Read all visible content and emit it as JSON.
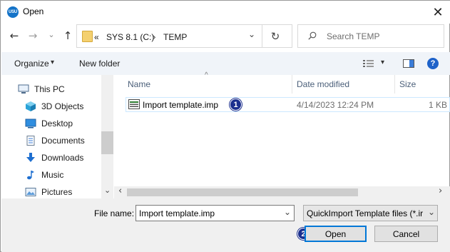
{
  "window": {
    "title": "Open",
    "app_icon_text": "USU",
    "close_glyph": "✕"
  },
  "nav": {
    "back_glyph": "←",
    "forward_glyph": "→",
    "recent_glyph": "⌄",
    "up_glyph": "↑"
  },
  "address": {
    "overflow": "«",
    "segments": [
      "SYS 8.1 (C:)",
      "TEMP"
    ],
    "separator": "›",
    "dropdown_glyph": "⌄",
    "refresh_glyph": "↻"
  },
  "search": {
    "placeholder": "Search TEMP"
  },
  "toolbar": {
    "organize_label": "Organize",
    "organize_arrow": "▾",
    "new_folder_label": "New folder",
    "view_arrow": "▾",
    "help_label": "?"
  },
  "sidebar": {
    "items": [
      {
        "label": "This PC",
        "icon": "computer-icon"
      },
      {
        "label": "3D Objects",
        "icon": "cube-icon"
      },
      {
        "label": "Desktop",
        "icon": "desktop-icon"
      },
      {
        "label": "Documents",
        "icon": "documents-icon"
      },
      {
        "label": "Downloads",
        "icon": "download-icon"
      },
      {
        "label": "Music",
        "icon": "music-icon"
      },
      {
        "label": "Pictures",
        "icon": "pictures-icon"
      }
    ],
    "scroll_down_glyph": "⌄"
  },
  "file_list": {
    "columns": [
      "Name",
      "Date modified",
      "Size"
    ],
    "sort_glyph": "^",
    "rows": [
      {
        "name": "Import template.imp",
        "date_modified": "4/14/2023 12:24 PM",
        "size": "1 KB"
      }
    ],
    "scroll_left_glyph": "‹",
    "scroll_right_glyph": "›"
  },
  "annotations": {
    "step1": "1",
    "step2": "2"
  },
  "bottom": {
    "file_name_label": "File name:",
    "file_name_value": "Import template.imp",
    "file_name_arrow": "⌄",
    "filter_value": "QuickImport Template files (*.ir",
    "filter_arrow": "⌄",
    "open_label": "Open",
    "cancel_label": "Cancel"
  },
  "colors": {
    "accent": "#0078d7",
    "selection_border": "#cce8ff",
    "badge": "#1b2f8e",
    "toolbar_bg": "#f0f4f9",
    "help": "#1e62c9"
  }
}
